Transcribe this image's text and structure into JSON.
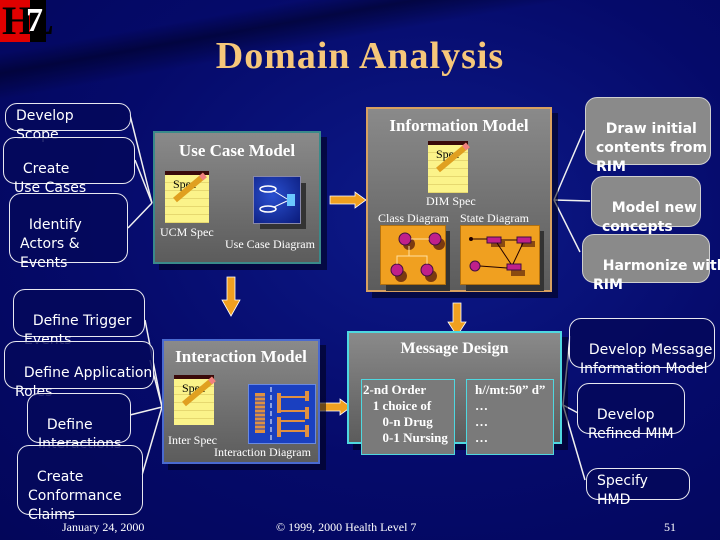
{
  "logo": {
    "text_h": "HL",
    "text_7": "7",
    "icon": "hl7-logo"
  },
  "title": "Domain Analysis",
  "use_case_activities": [
    "Develop Scope",
    "Create\nUse Cases",
    "Identify\nActors &\nEvents"
  ],
  "use_case_model": {
    "title": "Use Case Model",
    "spec_label": "Spec",
    "spec_caption": "UCM Spec",
    "diagram_caption": "Use Case Diagram"
  },
  "information_model": {
    "title": "Information Model",
    "spec_label": "Spec",
    "spec_caption": "DIM Spec",
    "class_caption": "Class Diagram",
    "state_caption": "State Diagram"
  },
  "information_activities": [
    "Draw initial\ncontents from\nRIM",
    "Model new\nconcepts",
    "Harmonize with\nRIM"
  ],
  "interaction_activities": [
    "Define Trigger\nEvents",
    "Define Application\nRoles",
    "Define\nInteractions",
    "Create\nConformance\nClaims"
  ],
  "interaction_model": {
    "title": "Interaction Model",
    "spec_label": "Spec",
    "spec_caption": "Inter Spec",
    "diagram_caption": "Interaction Diagram"
  },
  "message_design": {
    "title": "Message Design",
    "left_lines": "2-nd Order\n   1 choice of\n      0-n Drug\n      0-1 Nursing",
    "right_lines": "h//mt:50” d”\n…\n…\n…"
  },
  "message_activities": [
    "Develop Message\nInformation Model",
    "Develop\nRefined MIM",
    "Specify HMD"
  ],
  "footer": {
    "date": "January 24, 2000",
    "copyright": "© 1999, 2000  Health Level 7",
    "page": "51"
  },
  "colors": {
    "background": "#060a6e",
    "title": "#f6c77a",
    "arrow": "#f0a020",
    "info_border": "#d8a060",
    "msg_border": "#4fd8e0"
  }
}
